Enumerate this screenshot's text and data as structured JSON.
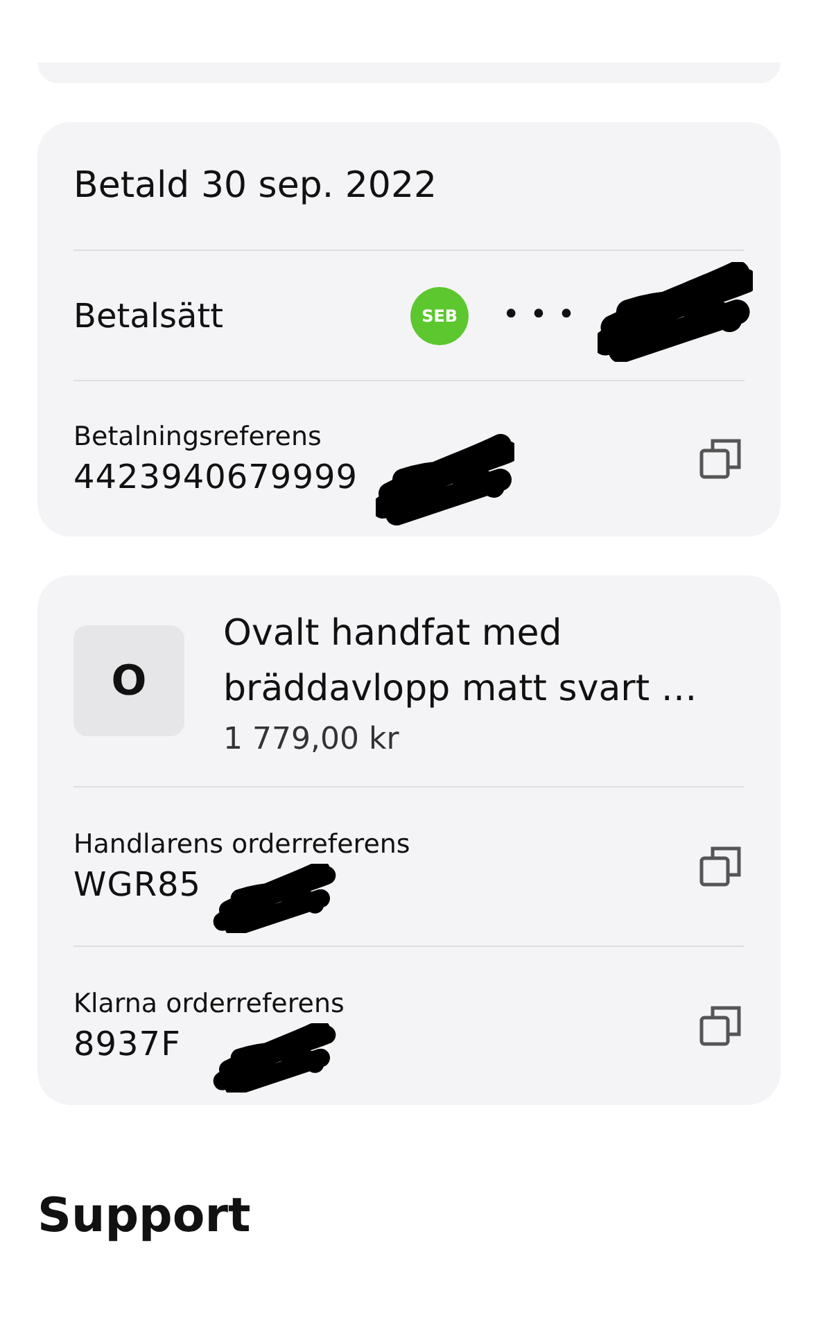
{
  "payment": {
    "status": "Betald 30 sep. 2022",
    "method": {
      "label": "Betalsätt",
      "bank": "SEB",
      "masked": "• • •"
    },
    "reference": {
      "label": "Betalningsreferens",
      "value": "4423940679999"
    }
  },
  "order": {
    "item": {
      "initial": "O",
      "name": "Ovalt handfat med bräddavlopp matt svart …",
      "price": "1 779,00 kr"
    },
    "references": [
      {
        "label": "Handlarens orderreferens",
        "value": "WGR85"
      },
      {
        "label": "Klarna orderreferens",
        "value": "8937F"
      }
    ]
  },
  "support": {
    "title": "Support"
  }
}
